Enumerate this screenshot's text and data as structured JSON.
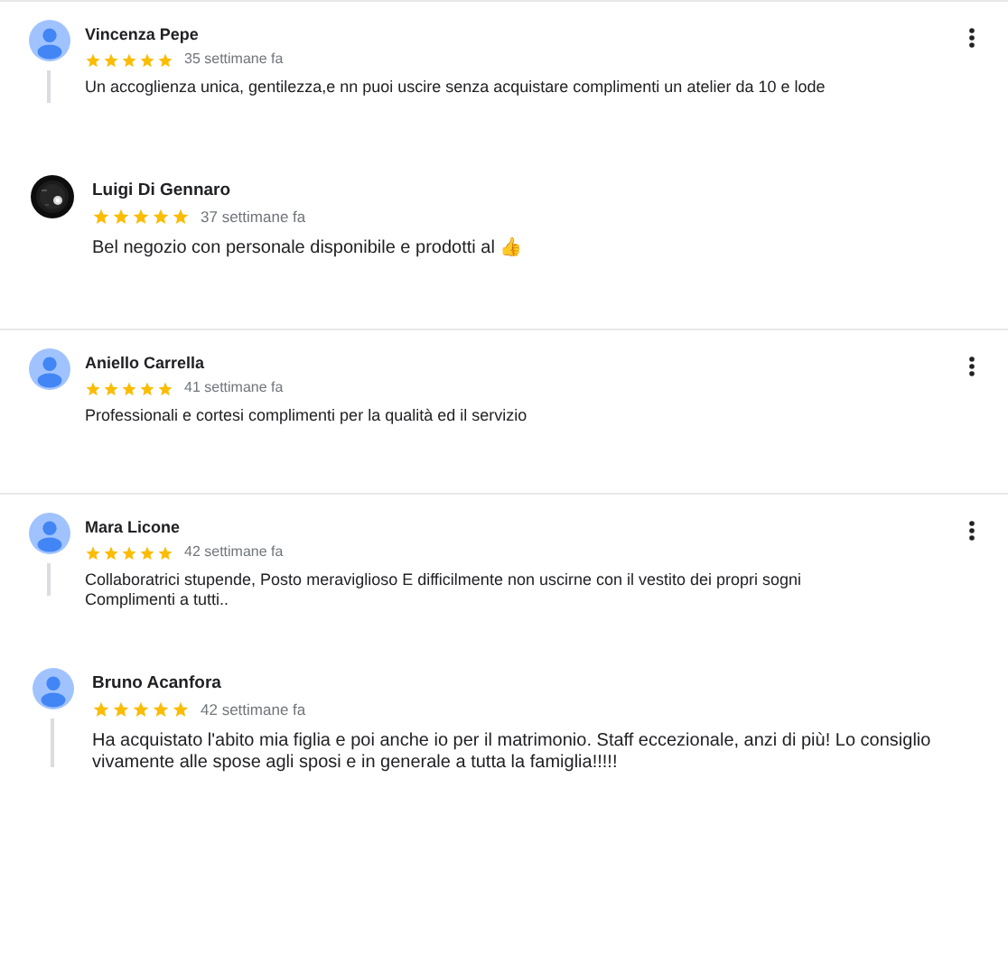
{
  "reviews": [
    {
      "kind": "compact",
      "avatar": {
        "kind": "silhouette"
      },
      "name": "Vincenza Pepe",
      "stars": 5,
      "time": "35 settimane fa",
      "text": "Un accoglienza unica, gentilezza,e nn puoi uscire senza acquistare complimenti un atelier da 10 e lode",
      "menu": true,
      "thread": true,
      "divider": false
    },
    {
      "kind": "large",
      "name": "Luigi Di Gennaro",
      "stars": 5,
      "time": "37 settimane fa",
      "text": "Bel negozio con personale disponibile e prodotti al 👍",
      "menu": false,
      "thread": false,
      "divider": true
    },
    {
      "kind": "compact",
      "avatar": {
        "kind": "silhouette"
      },
      "name": "Aniello Carrella",
      "stars": 5,
      "time": "41 settimane fa",
      "text": "Professionali e cortesi complimenti per la qualità ed il servizio",
      "menu": true,
      "thread": false,
      "divider": true
    },
    {
      "kind": "compact",
      "avatar": {
        "kind": "silhouette"
      },
      "name": "Mara Licone",
      "stars": 5,
      "time": "42 settimane fa",
      "text": "Collaboratrici stupende, Posto meraviglioso E difficilmente non uscirne con il vestito dei propri sogni Complimenti a tutti..",
      "menu": true,
      "thread": true,
      "divider": false
    },
    {
      "kind": "large",
      "avatar": {
        "kind": "silhouette"
      },
      "name": "Bruno Acanfora",
      "stars": 5,
      "time": "42 settimane fa",
      "text": "Ha acquistato l'abito mia figlia e poi anche io per il matrimonio. Staff eccezionale, anzi di più! Lo consiglio vivamente alle spose agli sposi e in generale a tutta la famiglia!!!!!",
      "menu": false,
      "thread": true,
      "divider": false
    }
  ]
}
